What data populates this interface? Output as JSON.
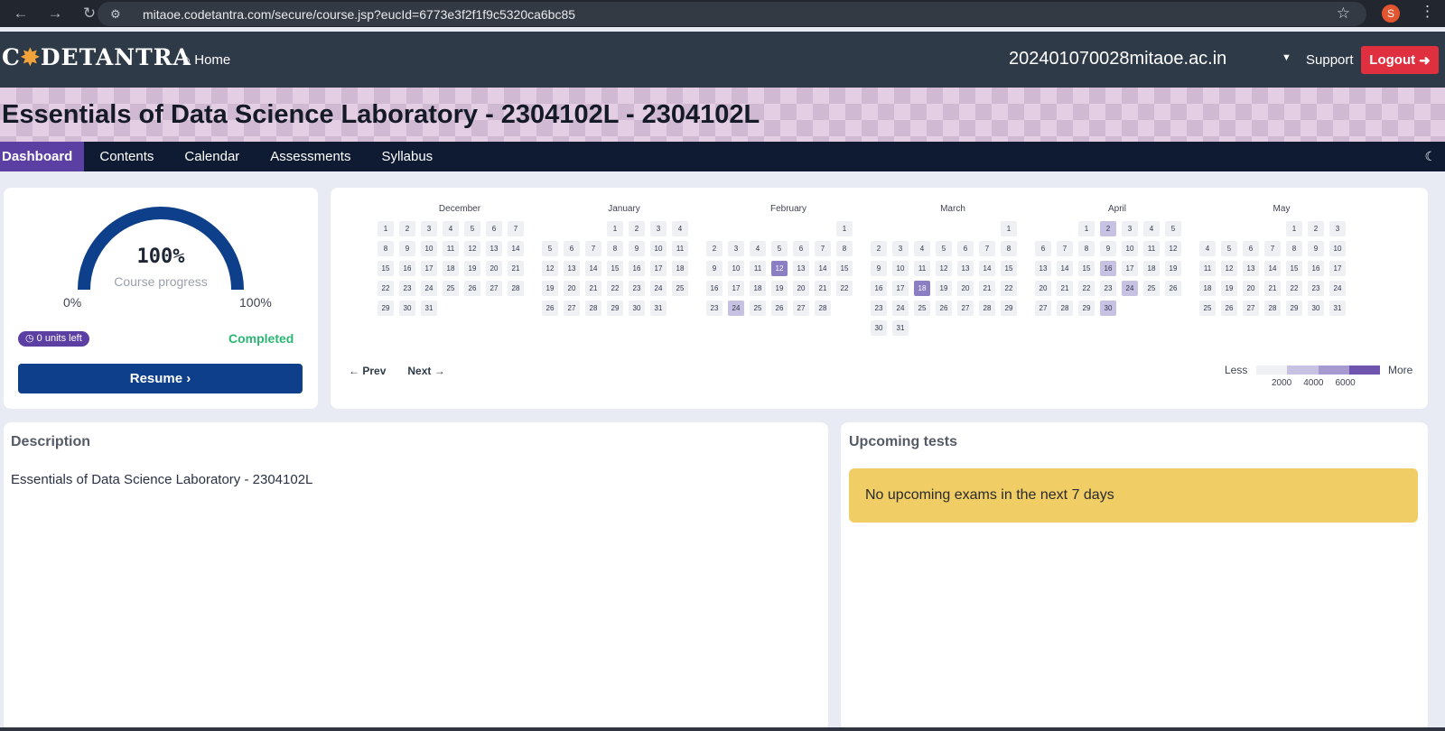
{
  "browser": {
    "url": "mitaoe.codetantra.com/secure/course.jsp?eucId=6773e3f2f1f9c5320ca6bc85",
    "profile_initial": "S"
  },
  "topnav": {
    "logo_text": "CODETANTRA",
    "home_label": "Home",
    "user": "202401070028mitaoe.ac.in",
    "support_label": "Support",
    "logout_label": "Logout"
  },
  "course": {
    "title": "Essentials of Data Science Laboratory - 2304102L - 2304102L"
  },
  "tabs": [
    {
      "label": "Dashboard",
      "active": true
    },
    {
      "label": "Contents",
      "active": false
    },
    {
      "label": "Calendar",
      "active": false
    },
    {
      "label": "Assessments",
      "active": false
    },
    {
      "label": "Syllabus",
      "active": false
    }
  ],
  "progress": {
    "value_text": "100%",
    "value": 1.0,
    "label": "Course progress",
    "min_label": "0%",
    "max_label": "100%",
    "units_left": "0 units left",
    "status": "Completed",
    "resume_label": "Resume"
  },
  "heatmap": {
    "months": [
      {
        "name": "December",
        "offset": 0,
        "days": 31,
        "l1": [],
        "l2": []
      },
      {
        "name": "January",
        "offset": 3,
        "days": 31,
        "l1": [],
        "l2": []
      },
      {
        "name": "February",
        "offset": 6,
        "days": 28,
        "l1": [
          24
        ],
        "l2": [
          12
        ]
      },
      {
        "name": "March",
        "offset": 6,
        "days": 31,
        "l1": [],
        "l2": [
          18
        ]
      },
      {
        "name": "April",
        "offset": 2,
        "days": 30,
        "l1": [
          2,
          16,
          24,
          30
        ],
        "l2": []
      },
      {
        "name": "May",
        "offset": 4,
        "days": 31,
        "l1": [],
        "l2": []
      }
    ],
    "prev_label": "Prev",
    "next_label": "Next",
    "legend_less": "Less",
    "legend_more": "More",
    "legend_ticks": [
      "2000",
      "4000",
      "6000"
    ],
    "colors": [
      "#eef0f4",
      "#c8c2e2",
      "#a79ad0",
      "#6f54b0"
    ]
  },
  "description": {
    "heading": "Description",
    "text": "Essentials of Data Science Laboratory - 2304102L"
  },
  "upcoming": {
    "heading": "Upcoming tests",
    "message": "No upcoming exams in the next 7 days"
  }
}
